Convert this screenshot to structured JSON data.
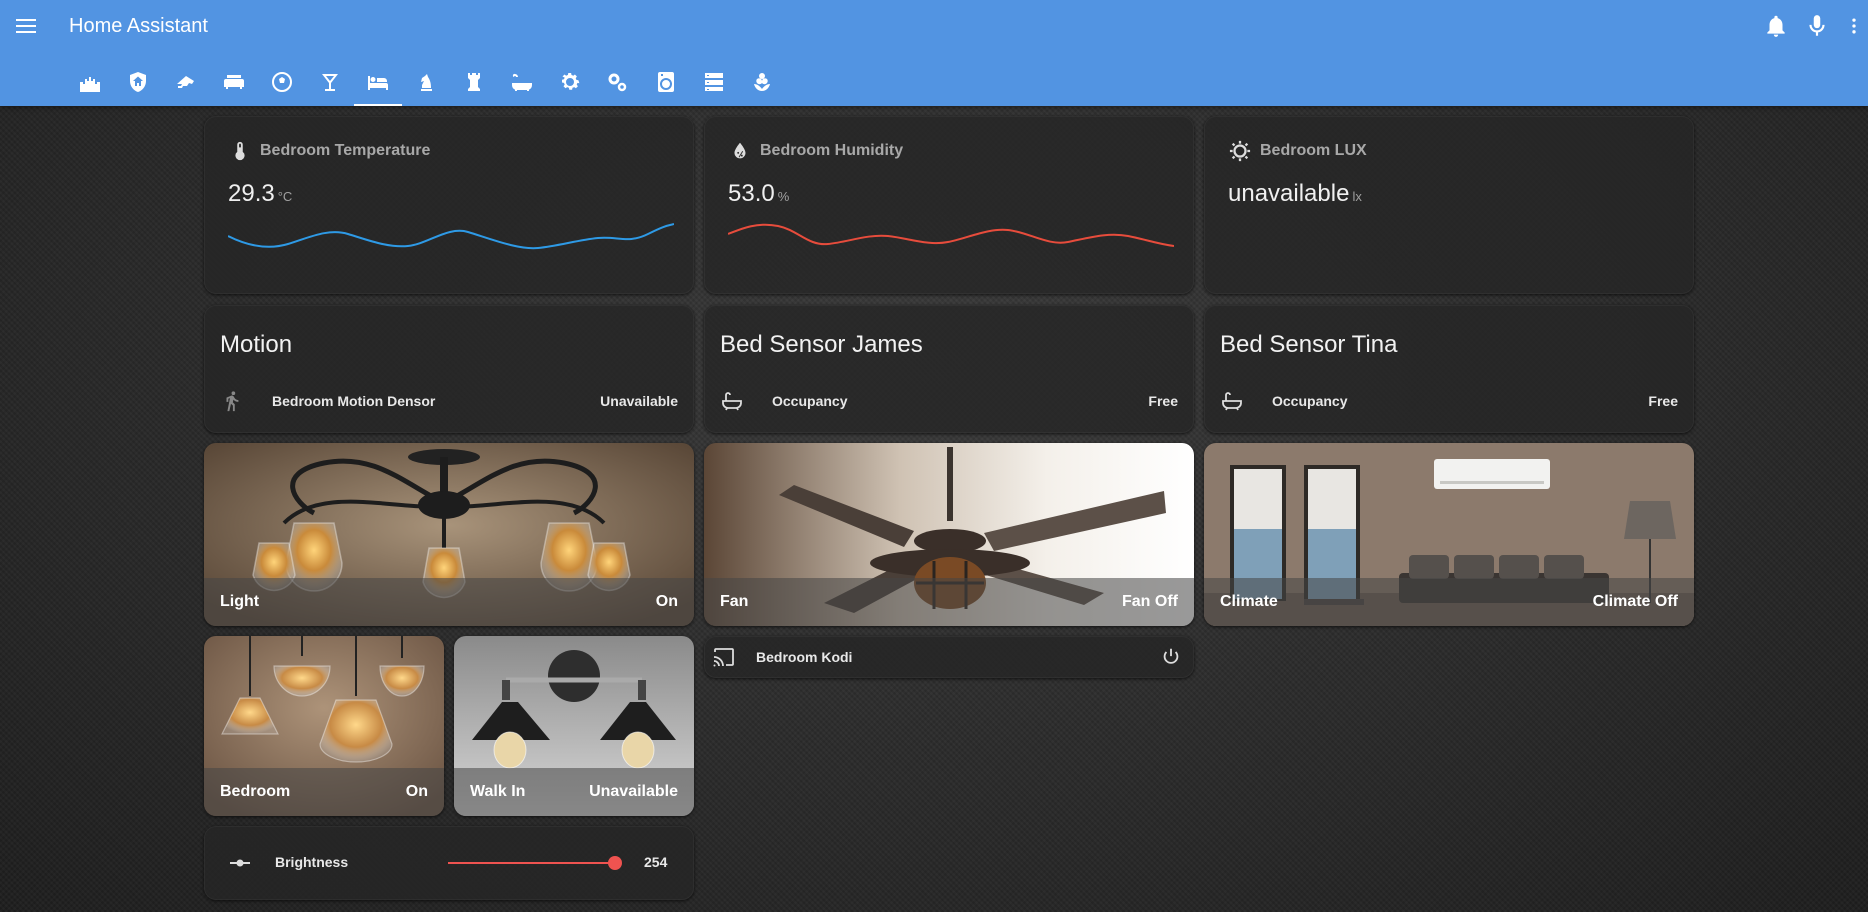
{
  "header": {
    "title": "Home Assistant",
    "icons": [
      "menu-icon",
      "bell-icon",
      "microphone-icon",
      "more-vert-icon"
    ],
    "color": "#5294e2"
  },
  "tabs": {
    "active_index": 6,
    "icons": [
      "castle-icon",
      "shield-home-icon",
      "cctv-icon",
      "sofa-icon",
      "soccer-ball-icon",
      "cocktail-glass-icon",
      "bed-icon",
      "chess-knight-icon",
      "chess-rook-icon",
      "bathtub-icon",
      "gear-icon",
      "gears-icon",
      "washing-machine-icon",
      "server-icon",
      "flower-icon"
    ]
  },
  "sensors": [
    {
      "name": "Bedroom Temperature",
      "value": "29.3",
      "unit": "°C",
      "icon": "thermometer-icon",
      "line_color": "#2e9ae6"
    },
    {
      "name": "Bedroom Humidity",
      "value": "53.0",
      "unit": "%",
      "icon": "water-percent-icon",
      "line_color": "#e74c3c"
    },
    {
      "name": "Bedroom LUX",
      "value": "unavailable",
      "unit": "lx",
      "icon": "brightness-icon"
    }
  ],
  "entity_cards": [
    {
      "title": "Motion",
      "row_label": "Bedroom Motion Densor",
      "row_state": "Unavailable",
      "icon": "walk-icon"
    },
    {
      "title": "Bed Sensor James",
      "row_label": "Occupancy",
      "row_state": "Free",
      "icon": "bathtub-icon"
    },
    {
      "title": "Bed Sensor Tina",
      "row_label": "Occupancy",
      "row_state": "Free",
      "icon": "bathtub-icon"
    }
  ],
  "picture_cards": [
    {
      "name": "Light",
      "state": "On"
    },
    {
      "name": "Fan",
      "state": "Fan Off"
    },
    {
      "name": "Climate",
      "state": "Climate Off"
    },
    {
      "name": "Bedroom",
      "state": "On"
    },
    {
      "name": "Walk In",
      "state": "Unavailable"
    }
  ],
  "media": {
    "label": "Bedroom Kodi",
    "icon": "cast-icon",
    "power_icon": "power-icon"
  },
  "brightness": {
    "label": "Brightness",
    "value": "254",
    "max": 255,
    "icon": "slider-icon",
    "accent": "#ef5350"
  }
}
